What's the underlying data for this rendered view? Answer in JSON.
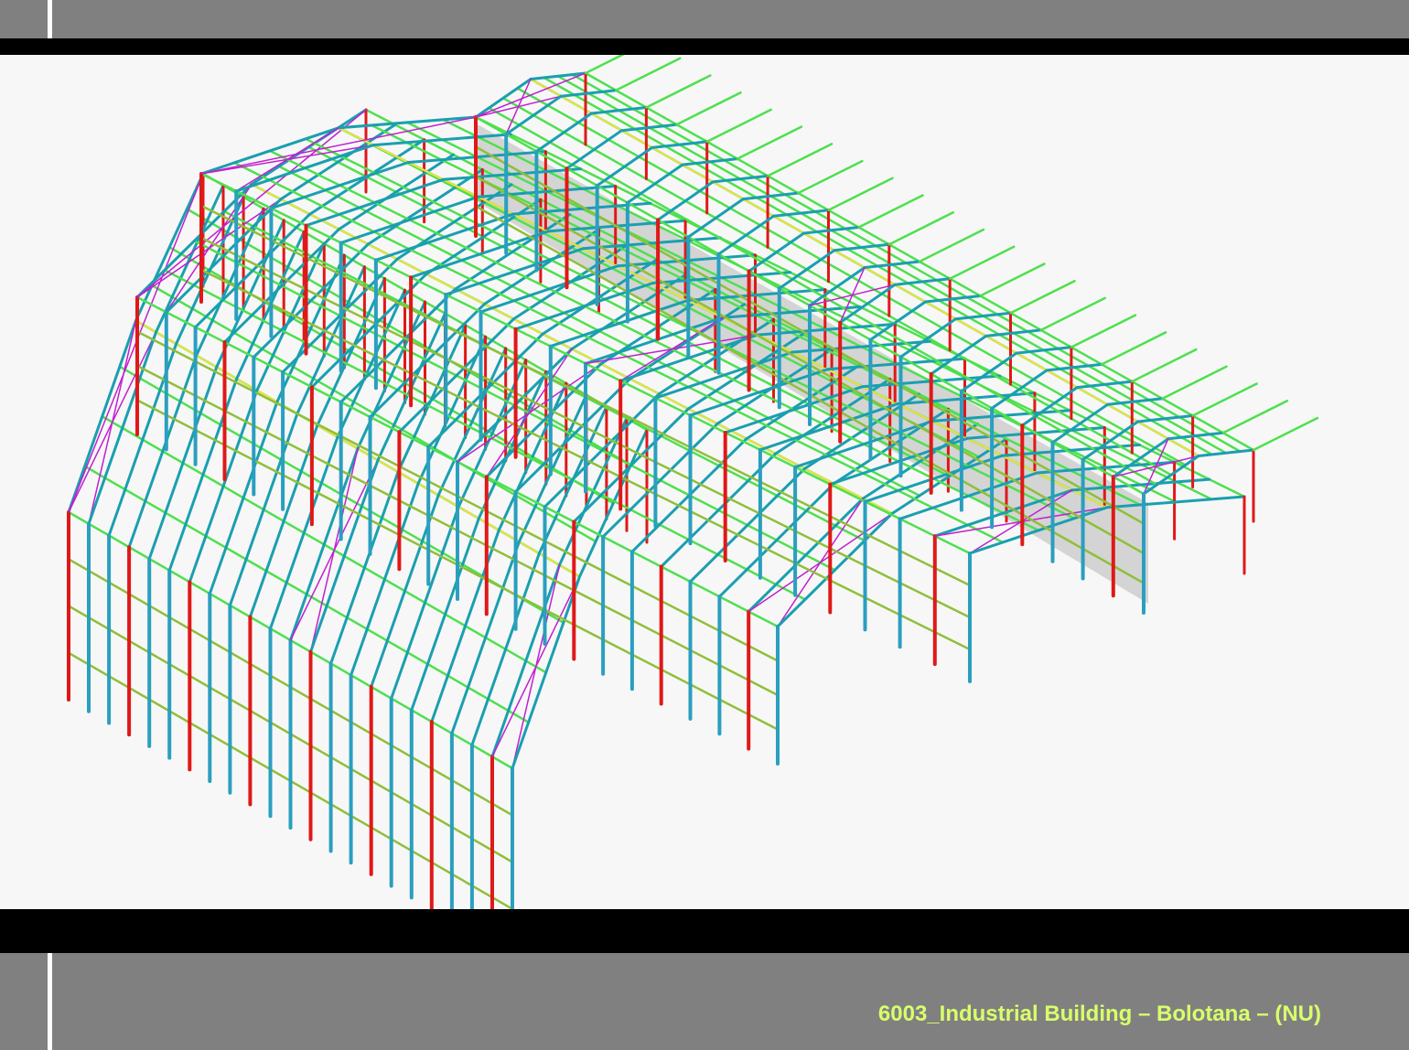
{
  "caption": "6003_Industrial Building – Bolotana – (NU)",
  "colors": {
    "frame_bands": "#808080",
    "bars": "#000000",
    "caption": "#d8ff6a",
    "columns_main": "#e01818",
    "columns_secondary": "#2a9fbf",
    "rafters": "#1a9fb0",
    "purlins": "#4ee04e",
    "bracing": "#c020d0",
    "ridge_truss": "#f0e040",
    "wall_panel": "#c8c8c8"
  },
  "model": {
    "bays": 4,
    "frames_per_bay": 22,
    "icons": [
      "steel-frame-3d-model"
    ]
  }
}
